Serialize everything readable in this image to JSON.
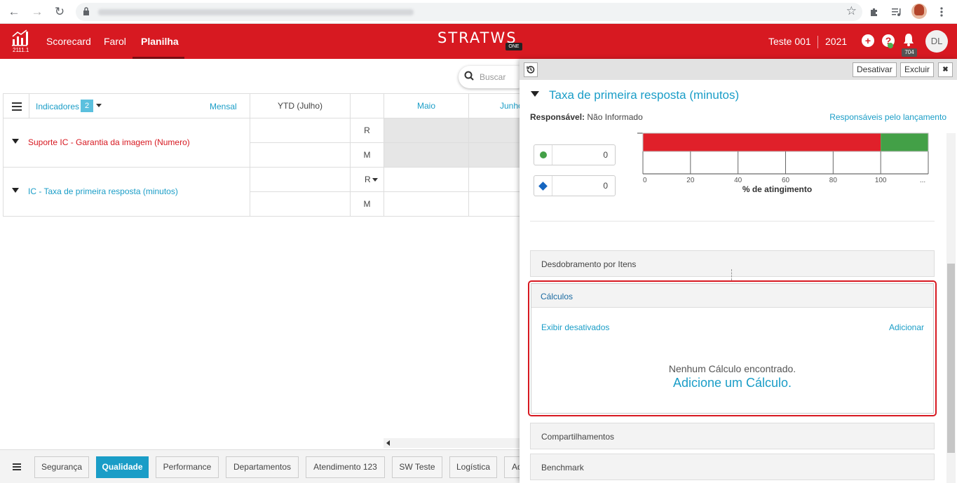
{
  "browser": {
    "back": "←",
    "forward": "→",
    "reload": "↻",
    "star": "☆"
  },
  "app": {
    "version": "2111.1",
    "nav": [
      "Scorecard",
      "Farol",
      "Planilha"
    ],
    "brand": "STRATWS",
    "brand_badge": "ONE",
    "user": "Teste 001",
    "year": "2021",
    "notifications": "704",
    "avatar": "DL",
    "accent": "#d71921",
    "link_color": "#1a9dc7"
  },
  "search": {
    "placeholder": "Buscar"
  },
  "grid": {
    "indicators_label": "Indicadores",
    "indicators_count": "2",
    "period": "Mensal",
    "ytd": "YTD (Julho)",
    "months": [
      "Maio",
      "Junho"
    ],
    "rows": [
      {
        "name": "Suporte IC - Garantia da imagem (Numero)",
        "r": "R",
        "m": "M"
      },
      {
        "name": "IC - Taxa de primeira resposta (minutos)",
        "r": "R",
        "m": "M"
      }
    ]
  },
  "panel": {
    "buttons": {
      "desativar": "Desativar",
      "excluir": "Excluir",
      "close": "✖"
    },
    "title": "Taxa de primeira resposta (minutos)",
    "resp_label": "Responsável:",
    "resp_value": "Não Informado",
    "resp_link": "Responsáveis pelo lançamento",
    "value_green": "0",
    "value_blue": "0",
    "sections": {
      "desdobramento": "Desdobramento por Itens",
      "calculos": "Cálculos",
      "exibir": "Exibir desativados",
      "adicionar": "Adicionar",
      "empty": "Nenhum Cálculo encontrado.",
      "add_calc": "Adicione um Cálculo.",
      "compartilhamentos": "Compartilhamentos",
      "benchmark": "Benchmark"
    }
  },
  "chart_data": {
    "type": "bar",
    "xlabel": "% de atingimento",
    "ticks": [
      "0",
      "20",
      "40",
      "60",
      "80",
      "100",
      "..."
    ],
    "tick_values": [
      0,
      20,
      40,
      60,
      80,
      100
    ],
    "xlim": [
      0,
      120
    ],
    "bands": [
      {
        "from": 0,
        "to": 100,
        "color": "#e0202a"
      },
      {
        "from": 100,
        "to": 120,
        "color": "#43a047"
      }
    ]
  },
  "tabs": [
    "Segurança",
    "Qualidade",
    "Performance",
    "Departamentos",
    "Atendimento 123",
    "SW Teste",
    "Logística",
    "Ad"
  ],
  "active_tab": "Qualidade"
}
